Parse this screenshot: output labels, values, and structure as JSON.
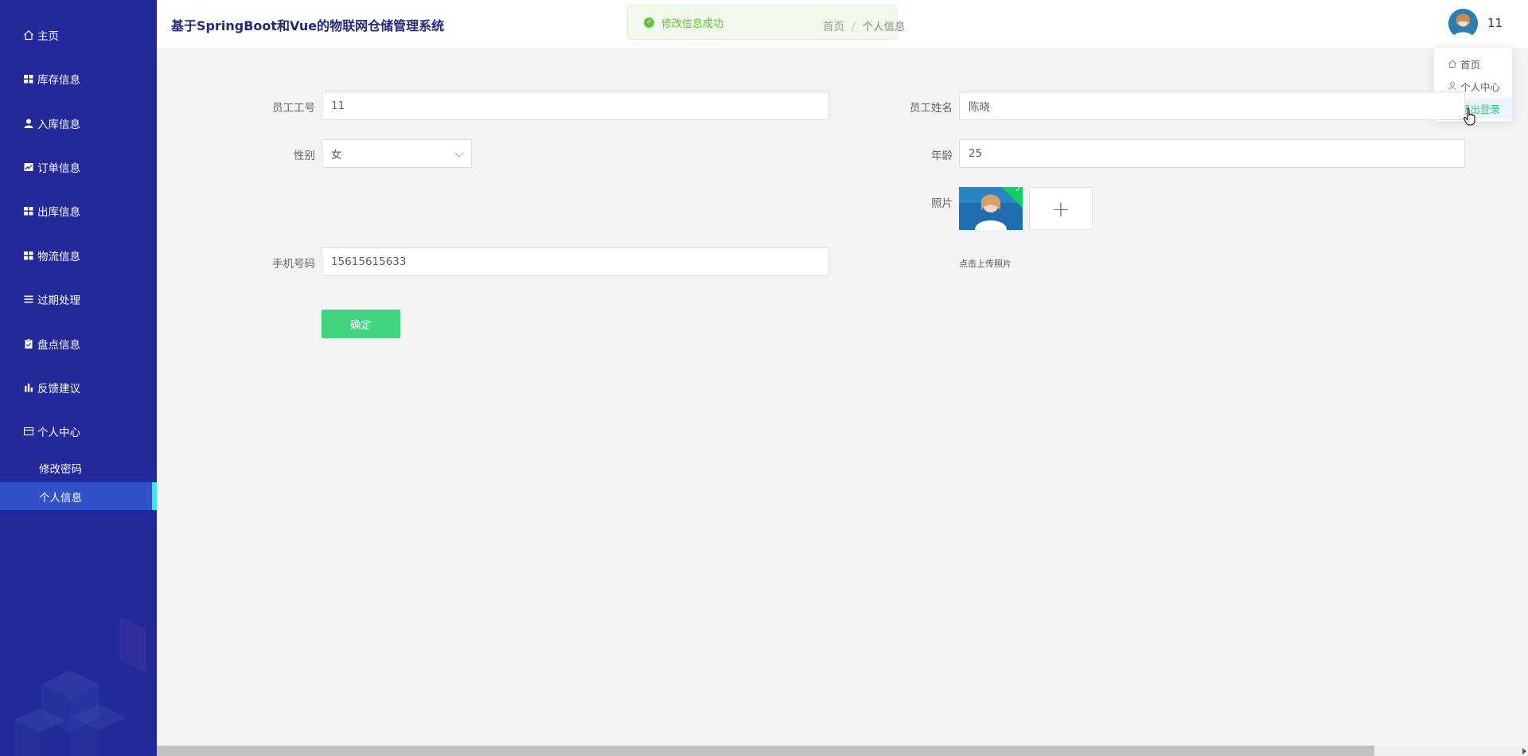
{
  "app": {
    "title": "基于SpringBoot和Vue的物联网仓储管理系统"
  },
  "toast": {
    "text": "修改信息成功"
  },
  "breadcrumb": {
    "home": "首页",
    "current": "个人信息",
    "separator": "/"
  },
  "user": {
    "name": "11"
  },
  "dropdown": {
    "items": [
      "首页",
      "个人中心",
      "退出登录"
    ]
  },
  "sidebar": {
    "items": [
      {
        "label": "主页",
        "icon": "home-icon"
      },
      {
        "label": "库存信息",
        "icon": "grid-icon"
      },
      {
        "label": "入库信息",
        "icon": "user-icon"
      },
      {
        "label": "订单信息",
        "icon": "chart-box-icon"
      },
      {
        "label": "出库信息",
        "icon": "grid-icon"
      },
      {
        "label": "物流信息",
        "icon": "grid-icon"
      },
      {
        "label": "过期处理",
        "icon": "list-icon"
      },
      {
        "label": "盘点信息",
        "icon": "clipboard-icon"
      },
      {
        "label": "反馈建议",
        "icon": "bar-chart-icon"
      },
      {
        "label": "个人中心",
        "icon": "card-icon"
      }
    ],
    "subitems": [
      {
        "label": "修改密码"
      },
      {
        "label": "个人信息"
      }
    ]
  },
  "form": {
    "employee_no": {
      "label": "员工工号",
      "value": "11"
    },
    "employee_name": {
      "label": "员工姓名",
      "value": "陈晓"
    },
    "gender": {
      "label": "性别",
      "value": "女"
    },
    "age": {
      "label": "年龄",
      "value": "25"
    },
    "photo": {
      "label": "照片",
      "upload_tip": "点击上传照片"
    },
    "phone": {
      "label": "手机号码",
      "value": "15615615633"
    },
    "confirm_label": "确定"
  },
  "colors": {
    "sidebar_bg": "#23299a",
    "sidebar_active": "#3152c9",
    "active_indicator": "#33e6f2",
    "primary_button": "#40d47e",
    "success": "#67c23a"
  }
}
